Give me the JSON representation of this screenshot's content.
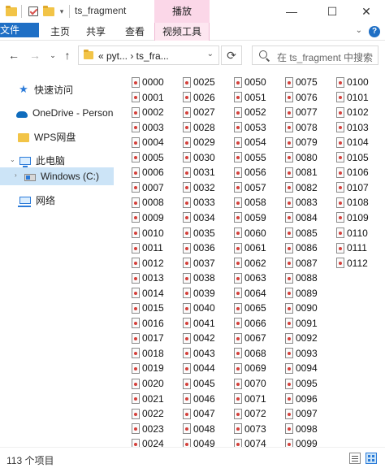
{
  "window": {
    "title": "ts_fragment",
    "context_tab": "播放",
    "buttons": {
      "minimize": "—",
      "maximize": "☐",
      "close": "✕"
    }
  },
  "ribbon": {
    "tabs": [
      "文件",
      "主页",
      "共享",
      "查看",
      "视频工具"
    ],
    "collapse_glyph": "⌄",
    "help_glyph": "?"
  },
  "address": {
    "path": "« pyt... › ts_fra...",
    "refresh_glyph": "⟳"
  },
  "search": {
    "placeholder": "在 ts_fragment 中搜索"
  },
  "sidebar": {
    "items": [
      {
        "label": "快速访问",
        "icon": "star-icon"
      },
      {
        "label": "OneDrive - Persona",
        "icon": "cloud-icon"
      },
      {
        "label": "WPS网盘",
        "icon": "folder-icon"
      },
      {
        "label": "此电脑",
        "icon": "computer-icon"
      },
      {
        "label": "Windows (C:)",
        "icon": "drive-icon"
      },
      {
        "label": "网络",
        "icon": "network-icon"
      }
    ]
  },
  "files": [
    "0000",
    "0001",
    "0002",
    "0003",
    "0004",
    "0005",
    "0006",
    "0007",
    "0008",
    "0009",
    "0010",
    "0011",
    "0012",
    "0013",
    "0014",
    "0015",
    "0016",
    "0017",
    "0018",
    "0019",
    "0020",
    "0021",
    "0022",
    "0023",
    "0024",
    "0025",
    "0026",
    "0027",
    "0028",
    "0029",
    "0030",
    "0031",
    "0032",
    "0033",
    "0034",
    "0035",
    "0036",
    "0037",
    "0038",
    "0039",
    "0040",
    "0041",
    "0042",
    "0043",
    "0044",
    "0045",
    "0046",
    "0047",
    "0048",
    "0049",
    "0050",
    "0051",
    "0052",
    "0053",
    "0054",
    "0055",
    "0056",
    "0057",
    "0058",
    "0059",
    "0060",
    "0061",
    "0062",
    "0063",
    "0064",
    "0065",
    "0066",
    "0067",
    "0068",
    "0069",
    "0070",
    "0071",
    "0072",
    "0073",
    "0074",
    "0075",
    "0076",
    "0077",
    "0078",
    "0079",
    "0080",
    "0081",
    "0082",
    "0083",
    "0084",
    "0085",
    "0086",
    "0087",
    "0088",
    "0089",
    "0090",
    "0091",
    "0092",
    "0093",
    "0094",
    "0095",
    "0096",
    "0097",
    "0098",
    "0099",
    "0100",
    "0101",
    "0102",
    "0103",
    "0104",
    "0105",
    "0106",
    "0107",
    "0108",
    "0109",
    "0110",
    "0111",
    "0112"
  ],
  "status": {
    "count": "113 个项目"
  },
  "colors": {
    "accent": "#1f6fc5",
    "selection": "#cce4f7",
    "context_tab": "#fbd7e8"
  }
}
